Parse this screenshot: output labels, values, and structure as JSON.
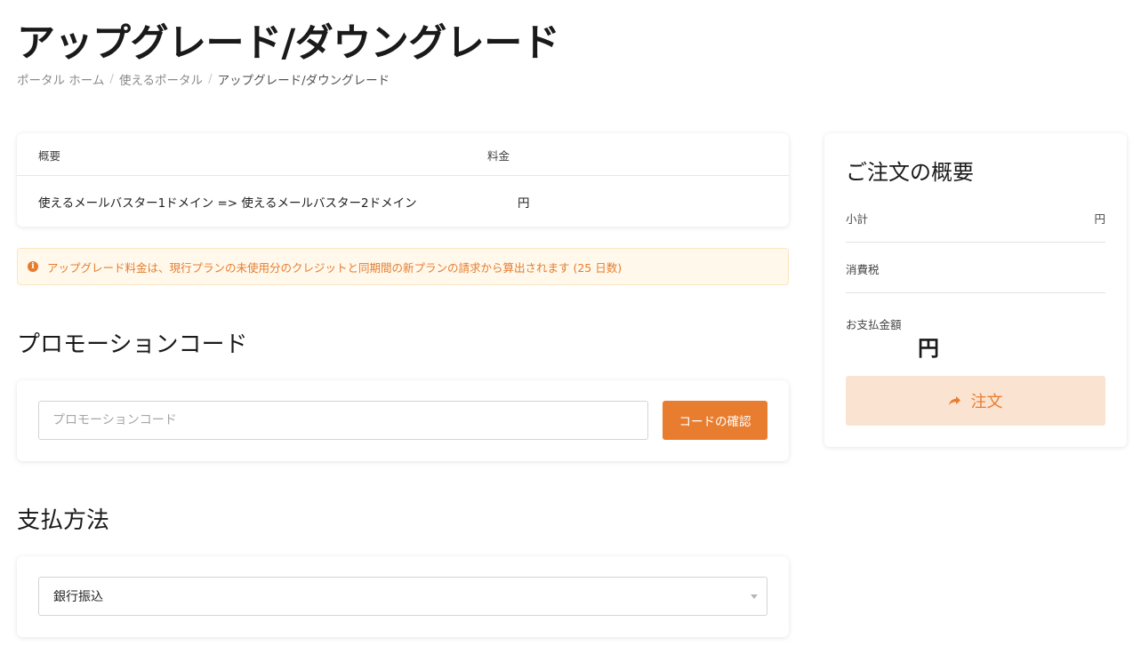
{
  "header": {
    "title": "アップグレード/ダウングレード",
    "breadcrumb": {
      "home": "ポータル ホーム",
      "separator": "/",
      "parent": "使えるポータル",
      "current": "アップグレード/ダウングレード"
    }
  },
  "overview": {
    "col_summary": "概要",
    "col_price": "料金",
    "row_description": "使えるメールバスター1ドメイン => 使えるメールバスター2ドメイン",
    "row_price": "円"
  },
  "notice": {
    "icon": "info-circle-icon",
    "text": "アップグレード料金は、現行プランの未使用分のクレジットと同期間の新プランの請求から算出されます (25 日数)"
  },
  "promo": {
    "section_title": "プロモーションコード",
    "input_placeholder": "プロモーションコード",
    "input_value": "",
    "button_label": "コードの確認"
  },
  "payment": {
    "section_title": "支払方法",
    "selected": "銀行振込"
  },
  "summary": {
    "title": "ご注文の概要",
    "subtotal_label": "小計",
    "subtotal_value": "円",
    "tax_label": "消費税",
    "tax_value": "",
    "total_label": "お支払金額",
    "total_value": "円",
    "order_button_label": "注文",
    "order_button_icon": "share-arrow-icon"
  },
  "colors": {
    "accent": "#e87d2f",
    "notice_bg": "#fff8eb",
    "order_button_bg": "#fbe3d2"
  }
}
